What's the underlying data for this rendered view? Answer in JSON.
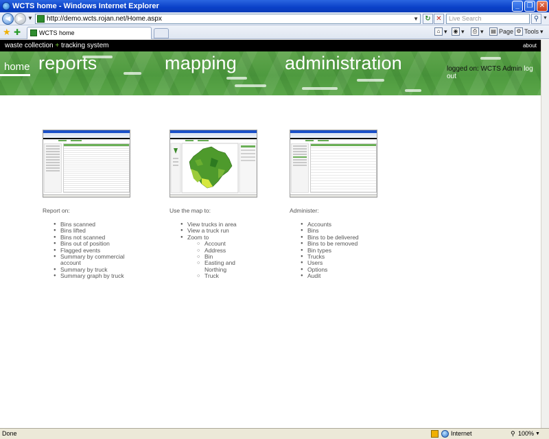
{
  "browser": {
    "window_title": "WCTS home - Windows Internet Explorer",
    "url": "http://demo.wcts.rojan.net/Home.aspx",
    "search_placeholder": "Live Search",
    "tab_title": "WCTS home",
    "commands": {
      "page": "Page",
      "tools": "Tools"
    },
    "status": {
      "left": "Done",
      "zone": "Internet",
      "zoom": "100%"
    }
  },
  "site": {
    "brand_left": "waste collection",
    "brand_plus": "+",
    "brand_right": "tracking system",
    "about": "about",
    "nav": {
      "home": "home",
      "reports": "reports",
      "mapping": "mapping",
      "administration": "administration"
    },
    "login_prefix": "logged on: WCTS Admin",
    "logout": "log out",
    "accent_color": "#5aa648"
  },
  "columns": {
    "reports": {
      "heading": "Report on:",
      "items": [
        "Bins scanned",
        "Bins lifted",
        "Bins not scanned",
        "Bins out of position",
        "Flagged events",
        "Summary by commercial account",
        "Summary by truck",
        "Summary graph by truck"
      ]
    },
    "mapping": {
      "heading": "Use the map to:",
      "items": [
        "View trucks in area",
        "View a truck run",
        "Zoom to"
      ],
      "zoom_items": [
        "Account",
        "Address",
        "Bin",
        "Easting and Northing",
        "Truck"
      ]
    },
    "admin": {
      "heading": "Administer:",
      "items": [
        "Accounts",
        "Bins",
        "Bins to be delivered",
        "Bins to be removed",
        "Bin types",
        "Trucks",
        "Users",
        "Options",
        "Audit"
      ]
    }
  }
}
